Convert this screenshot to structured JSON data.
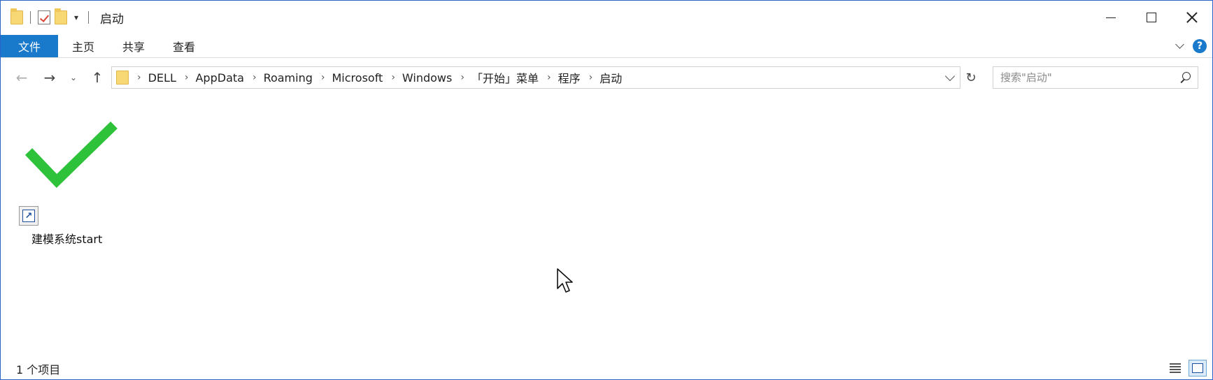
{
  "window": {
    "title": "启动"
  },
  "ribbon": {
    "tabs": [
      {
        "label": "文件"
      },
      {
        "label": "主页"
      },
      {
        "label": "共享"
      },
      {
        "label": "查看"
      }
    ],
    "help_label": "?"
  },
  "address": {
    "breadcrumbs": [
      "DELL",
      "AppData",
      "Roaming",
      "Microsoft",
      "Windows",
      "「开始」菜单",
      "程序",
      "启动"
    ]
  },
  "search": {
    "placeholder": "搜索\"启动\""
  },
  "files": [
    {
      "name": "建模系统start",
      "type": "shortcut"
    }
  ],
  "status": {
    "item_count": "1 个项目"
  },
  "colors": {
    "accent": "#1979ca",
    "check_green": "#2ec23a",
    "folder": "#f8d775"
  },
  "icons": {
    "back": "arrow-left-icon",
    "forward": "arrow-right-icon",
    "up": "arrow-up-icon",
    "refresh": "refresh-icon",
    "search": "search-icon"
  }
}
